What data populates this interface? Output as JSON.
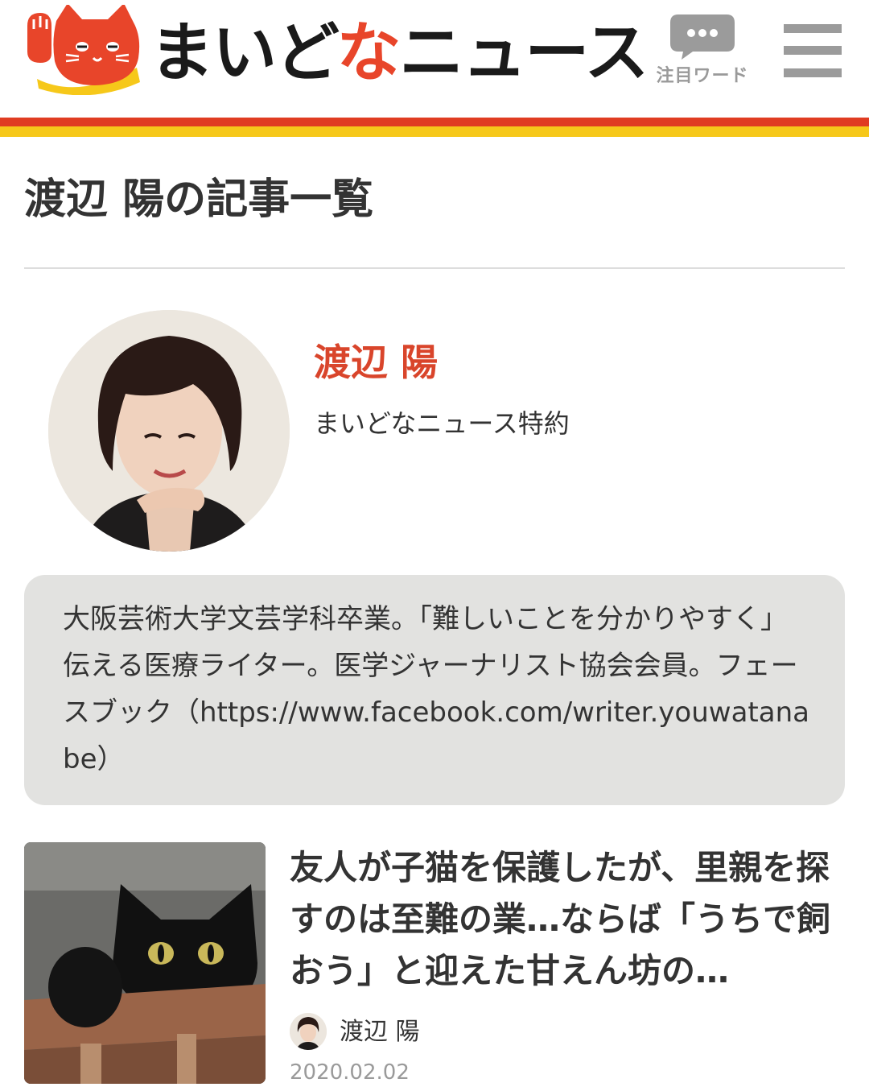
{
  "header": {
    "logo_text_part1": "まいど",
    "logo_text_accent": "な",
    "logo_text_part2": "ニュース",
    "keyword_label": "注目ワード",
    "menu_icon": "hamburger-menu-icon",
    "keyword_icon": "speech-bubble-icon",
    "colors": {
      "accent_red": "#e03c22",
      "accent_yellow": "#f6c81a",
      "name_red": "#d9452b"
    }
  },
  "page": {
    "title": "渡辺 陽の記事一覧"
  },
  "author": {
    "name": "渡辺 陽",
    "role": "まいどなニュース特約",
    "bio": "大阪芸術大学文芸学科卒業。「難しいことを分かりやすく」伝える医療ライター。医学ジャーナリスト協会会員。フェースブック（https://www.facebook.com/writer.youwatanabe）"
  },
  "articles": [
    {
      "title": "友人が子猫を保護したが、里親を探すのは至難の業…ならば「うちで飼おう」と迎えた甘えん坊の…",
      "author": "渡辺 陽",
      "date": "2020.02.02"
    }
  ]
}
